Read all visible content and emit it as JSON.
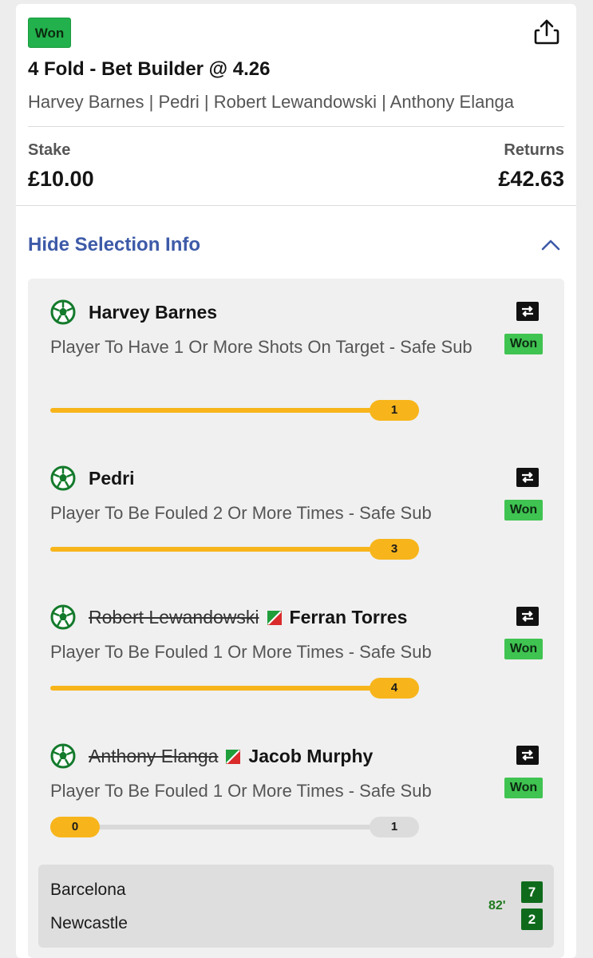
{
  "bet": {
    "status": "Won",
    "title": "4 Fold - Bet Builder @ 4.26",
    "players_summary": "Harvey Barnes | Pedri | Robert Lewandowski | Anthony Elanga",
    "stake_label": "Stake",
    "stake_value": "£10.00",
    "returns_label": "Returns",
    "returns_value": "£42.63",
    "hide_info_label": "Hide Selection Info"
  },
  "selections": [
    {
      "player": "Harvey Barnes",
      "market": "Player To Have 1 Or More Shots On Target - Safe Sub",
      "status": "Won",
      "progress": {
        "current": "1",
        "target": "1",
        "fraction": 1.0
      }
    },
    {
      "player": "Pedri",
      "market": "Player To Be Fouled 2 Or More Times - Safe Sub",
      "status": "Won",
      "progress": {
        "current": "3",
        "target": "2",
        "fraction": 1.0
      }
    },
    {
      "original_player": "Robert Lewandowski",
      "player": "Ferran Torres",
      "market": "Player To Be Fouled 1 Or More Times - Safe Sub",
      "status": "Won",
      "progress": {
        "current": "4",
        "target": "1",
        "fraction": 1.0
      }
    },
    {
      "original_player": "Anthony Elanga",
      "player": "Jacob Murphy",
      "market": "Player To Be Fouled 1 Or More Times - Safe Sub",
      "status": "Won",
      "progress": {
        "current": "0",
        "target": "1",
        "fraction": 0.0
      }
    }
  ],
  "match": {
    "home_team": "Barcelona",
    "away_team": "Newcastle",
    "minute": "82'",
    "home_score": "7",
    "away_score": "2"
  },
  "colors": {
    "won_green": "#22b14c",
    "progress_yellow": "#f7b51b",
    "link_blue": "#3d5aa8",
    "score_green": "#0f6b1c"
  },
  "icons": [
    "share-icon",
    "chevron-up-icon",
    "football-icon",
    "substitution-arrow-icon",
    "swap-icon"
  ]
}
